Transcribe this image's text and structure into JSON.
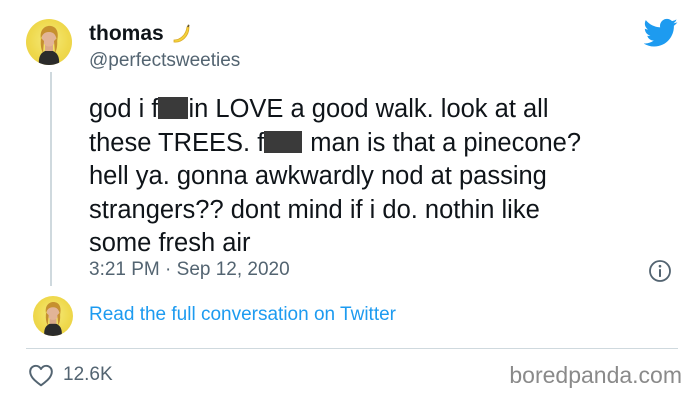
{
  "user": {
    "display_name": "thomas",
    "name_emoji": "banana-emoji",
    "handle": "@perfectsweeties"
  },
  "tweet": {
    "segments": {
      "s1": "god i f",
      "s2": "in LOVE a good walk. look at all\nthese TREES. f",
      "s3": "man is that a pinecone?\nhell ya. gonna awkwardly nod at passing\nstrangers?? dont mind if i do. nothin like\nsome fresh air"
    },
    "timestamp": "3:21 PM · Sep 12, 2020"
  },
  "conversation_link": "Read the full conversation on Twitter",
  "likes": {
    "count": "12.6K"
  },
  "watermark": "boredpanda.com",
  "icons": {
    "brand": "twitter-bird-icon",
    "info": "info-icon",
    "like": "heart-icon"
  },
  "colors": {
    "twitter_blue": "#1d9bf0",
    "secondary_text": "#536471",
    "avatar_bg": "#efd94e"
  }
}
